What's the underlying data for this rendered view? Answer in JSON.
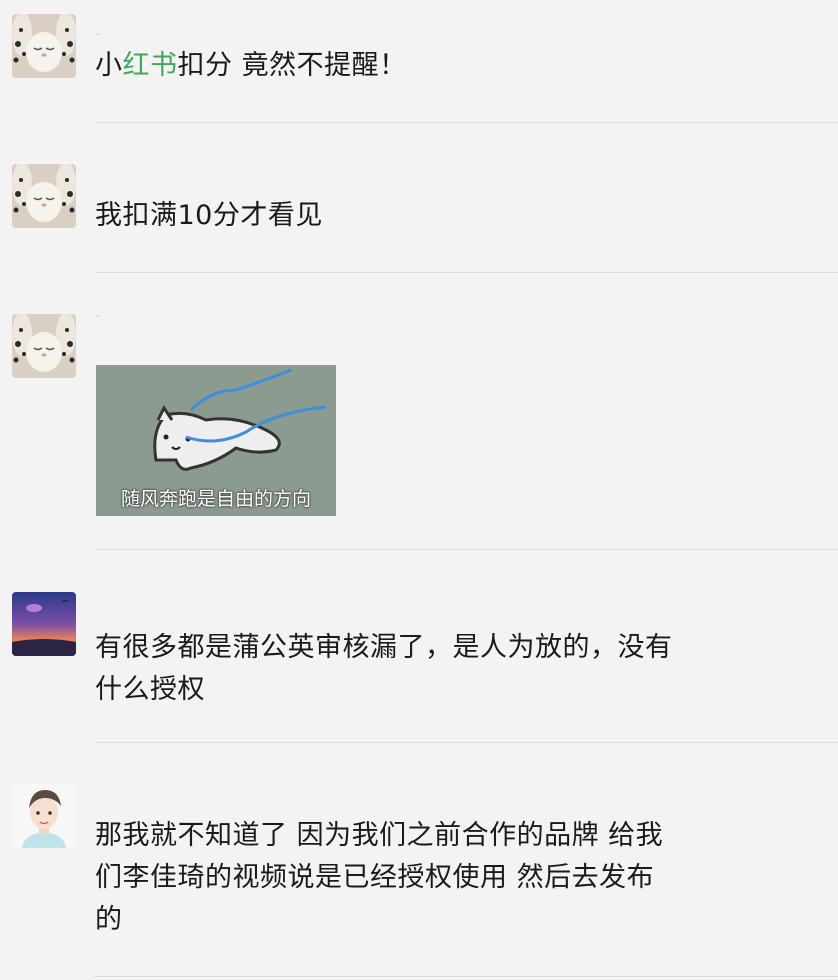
{
  "messages": [
    {
      "avatar": "cat-avatar-icon",
      "sender": "·",
      "text_parts": [
        "小",
        "红书",
        "扣分 竟然不提醒！"
      ]
    },
    {
      "avatar": "cat-avatar-icon",
      "text": "我扣满10分才看见"
    },
    {
      "avatar": "cat-avatar-icon",
      "sender": "·",
      "sticker_caption": "随风奔跑是自由的方向"
    },
    {
      "avatar": "sunset-avatar-icon",
      "lines": [
        "有很多都是蒲公英审核漏了，是人为放的，没有",
        "什么授权"
      ]
    },
    {
      "avatar": "cartoon-boy-avatar-icon",
      "lines": [
        "那我就不知道了 因为我们之前合作的品牌 给我",
        "们李佳琦的视频说是已经授权使用 然后去发布",
        "的"
      ]
    }
  ],
  "colors": {
    "background": "#f3f3f3",
    "keyword_green": "#43a65a",
    "separator": "#dcdcdc",
    "text": "#1a1a1a"
  }
}
